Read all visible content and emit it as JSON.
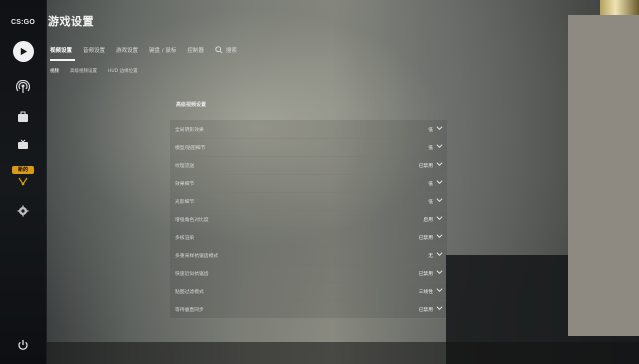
{
  "app": {
    "logo_text": "CS:GO",
    "title": "游戏设置"
  },
  "sidebar": {
    "new_badge": "新的"
  },
  "tabs": [
    {
      "label": "视频设置",
      "active": true
    },
    {
      "label": "音频设置",
      "active": false
    },
    {
      "label": "游戏设置",
      "active": false
    },
    {
      "label": "键盘 / 鼠标",
      "active": false
    },
    {
      "label": "控制器",
      "active": false
    }
  ],
  "search": {
    "label": "搜索"
  },
  "subtabs": [
    {
      "label": "视频",
      "active": true
    },
    {
      "label": "高级视频设置",
      "active": false
    },
    {
      "label": "HUD 边缘位置",
      "active": false
    }
  ],
  "settings": {
    "section_title": "高级视频设置",
    "rows": [
      {
        "label": "全局阴影效果",
        "value": "低"
      },
      {
        "label": "模型/贴图细节",
        "value": "低"
      },
      {
        "label": "纹理流送",
        "value": "已禁用"
      },
      {
        "label": "效果细节",
        "value": "低"
      },
      {
        "label": "光影细节",
        "value": "低"
      },
      {
        "label": "增强角色对比度",
        "value": "启用"
      },
      {
        "label": "多核渲染",
        "value": "已禁用"
      },
      {
        "label": "多重采样抗锯齿模式",
        "value": "无"
      },
      {
        "label": "快速近似抗锯齿",
        "value": "已禁用"
      },
      {
        "label": "贴图过滤模式",
        "value": "三线性"
      },
      {
        "label": "等待垂直同步",
        "value": "已禁用"
      }
    ]
  },
  "colors": {
    "accent": "#d99a16",
    "text": "#f0f0f0",
    "sidebar": "#121416"
  }
}
